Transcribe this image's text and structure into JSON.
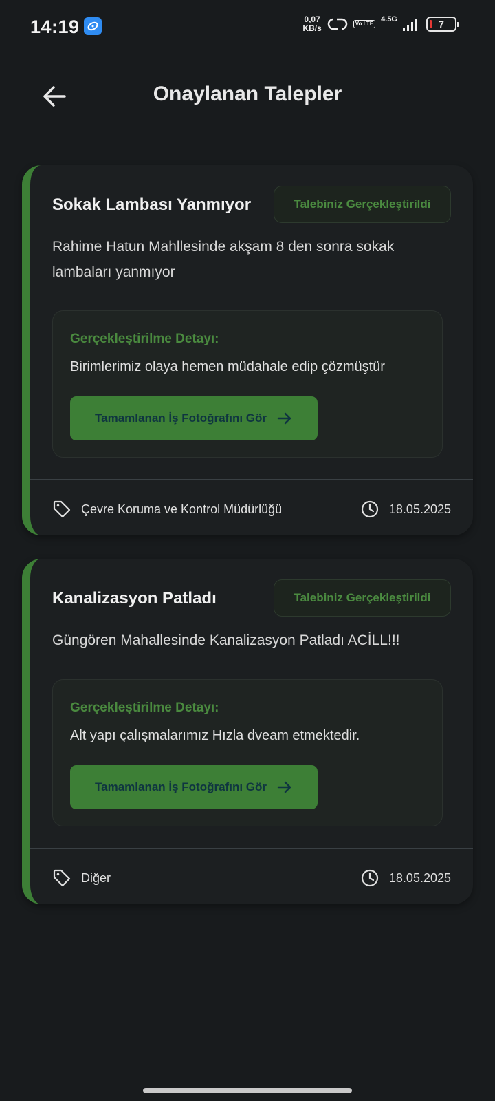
{
  "status_bar": {
    "time": "14:19",
    "net_speed_value": "0,07",
    "net_speed_unit": "KB/s",
    "volte": "Vo LTE",
    "network_type": "4.5G",
    "battery_level": "7"
  },
  "header": {
    "title": "Onaylanan Talepler"
  },
  "requests": [
    {
      "title": "Sokak Lambası Yanmıyor",
      "status": "Talebiniz Gerçekleştirildi",
      "description": "Rahime Hatun Mahllesinde akşam 8 den sonra sokak lambaları yanmıyor",
      "detail_label": "Gerçekleştirilme Detayı:",
      "detail_text": "Birimlerimiz olaya hemen müdahale edip çözmüştür",
      "photo_button": "Tamamlanan İş Fotoğrafını Gör",
      "category": "Çevre Koruma ve Kontrol Müdürlüğü",
      "date": "18.05.2025"
    },
    {
      "title": "Kanalizasyon Patladı",
      "status": "Talebiniz Gerçekleştirildi",
      "description": "Güngören Mahallesinde Kanalizasyon Patladı ACİLL!!!",
      "detail_label": "Gerçekleştirilme Detayı:",
      "detail_text": "Alt yapı çalışmalarımız Hızla dveam etmektedir.",
      "photo_button": "Tamamlanan İş Fotoğrafını Gör",
      "category": "Diğer",
      "date": "18.05.2025"
    }
  ],
  "colors": {
    "background": "#181b1d",
    "card": "#1c1f21",
    "accent_green": "#3d7f36",
    "status_green": "#4b8b40"
  }
}
